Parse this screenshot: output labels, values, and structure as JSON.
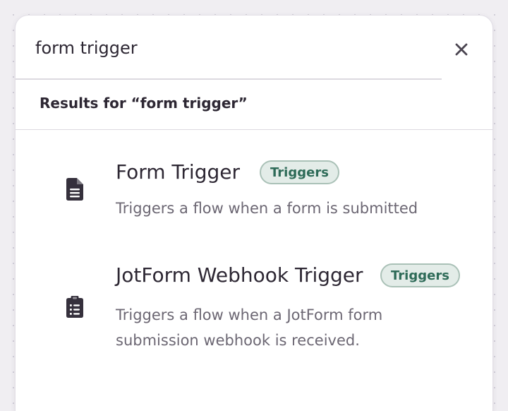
{
  "search": {
    "value": "form trigger",
    "close_icon": "close-icon"
  },
  "results_heading": "Results for “form trigger”",
  "results": [
    {
      "title": "Form Trigger",
      "badge": "Triggers",
      "description": "Triggers a flow when a form is submitted",
      "icon": "document-icon"
    },
    {
      "title": "JotForm Webhook Trigger",
      "badge": "Triggers",
      "description": "Triggers a flow when a JotForm form submission webhook is received.",
      "icon": "clipboard-list-icon"
    }
  ],
  "colors": {
    "text": "#2d2733",
    "muted_text": "#6c6773",
    "badge_bg": "#e3ece8",
    "badge_border": "#aac1b7",
    "badge_text": "#2e6b58",
    "icon": "#35303c"
  }
}
